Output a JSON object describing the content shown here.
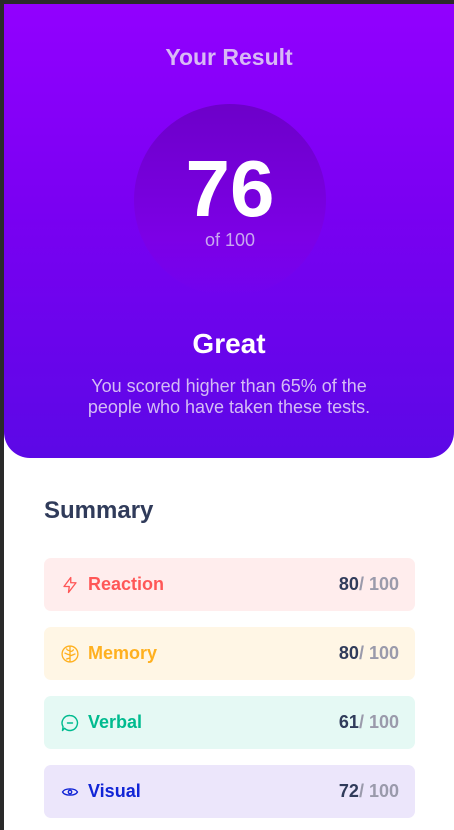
{
  "result": {
    "title": "Your Result",
    "score": "76",
    "out_of_label": "of 100",
    "rating": "Great",
    "description": "You scored higher than 65% of the people who have taken these tests."
  },
  "summary": {
    "title": "Summary",
    "items": [
      {
        "label": "Reaction",
        "score": "80",
        "out_of": " / 100",
        "icon": "lightning-icon",
        "color": "#ff5757",
        "bg": "#ffeded"
      },
      {
        "label": "Memory",
        "score": "80",
        "out_of": " / 100",
        "icon": "brain-icon",
        "color": "#ffb01f",
        "bg": "#fff6e5"
      },
      {
        "label": "Verbal",
        "score": "61",
        "out_of": " / 100",
        "icon": "chat-icon",
        "color": "#00bb8f",
        "bg": "#e5f9f4"
      },
      {
        "label": "Visual",
        "score": "72",
        "out_of": " / 100",
        "icon": "eye-icon",
        "color": "#1125d6",
        "bg": "#ece6fb"
      }
    ]
  },
  "colors": {
    "gradient_top": "#9200ff",
    "gradient_bottom": "#5c08e6",
    "heading": "#303b5a"
  }
}
